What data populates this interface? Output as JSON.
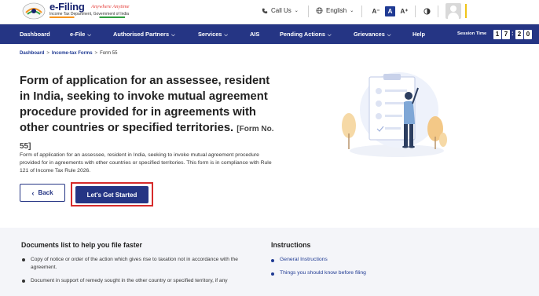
{
  "header": {
    "logo_title": "e-Filing",
    "logo_tagline": "Anywhere Anytime",
    "logo_subtitle": "Income Tax Department, Government of India",
    "call_us": "Call Us",
    "language": "English",
    "font_smaller": "A⁻",
    "font_normal": "A",
    "font_larger": "A⁺",
    "contrast_icon": "contrast-icon",
    "avatar_icon": "user-avatar-icon"
  },
  "nav": {
    "items": [
      {
        "label": "Dashboard",
        "has_dropdown": false
      },
      {
        "label": "e-File",
        "has_dropdown": true
      },
      {
        "label": "Authorised Partners",
        "has_dropdown": true
      },
      {
        "label": "Services",
        "has_dropdown": true
      },
      {
        "label": "AIS",
        "has_dropdown": false
      },
      {
        "label": "Pending Actions",
        "has_dropdown": true
      },
      {
        "label": "Grievances",
        "has_dropdown": true
      },
      {
        "label": "Help",
        "has_dropdown": false
      }
    ],
    "session_label": "Session Time",
    "session_digits": [
      "1",
      "7",
      "2",
      "0"
    ]
  },
  "breadcrumb": {
    "items": [
      "Dashboard",
      "Income-tax Forms",
      "Form 55"
    ]
  },
  "hero": {
    "title": "Form of application for an assessee, resident in India, seeking to invoke mutual agreement procedure provided for in agreements with other countries or specified territories.",
    "form_no": "[Form No. 55]",
    "description": "Form of application for an assessee, resident in India, seeking to invoke mutual agreement procedure provided for in agreements with other countries or specified territories. This form is in compliance with Rule 121 of Income Tax Rule 2026.",
    "back_label": "Back",
    "start_label": "Let's Get Started",
    "accent_color": "#253584",
    "highlight_color": "#d62b2b"
  },
  "documents": {
    "title": "Documents list to help you file faster",
    "items": [
      "Copy of notice or order of the action which gives rise to taxation not in accordance with the agreement.",
      "Document in support of remedy sought in the other country or specified territory, if any"
    ]
  },
  "instructions": {
    "title": "Instructions",
    "items": [
      "General Instructions",
      "Things you should know before filing"
    ]
  }
}
